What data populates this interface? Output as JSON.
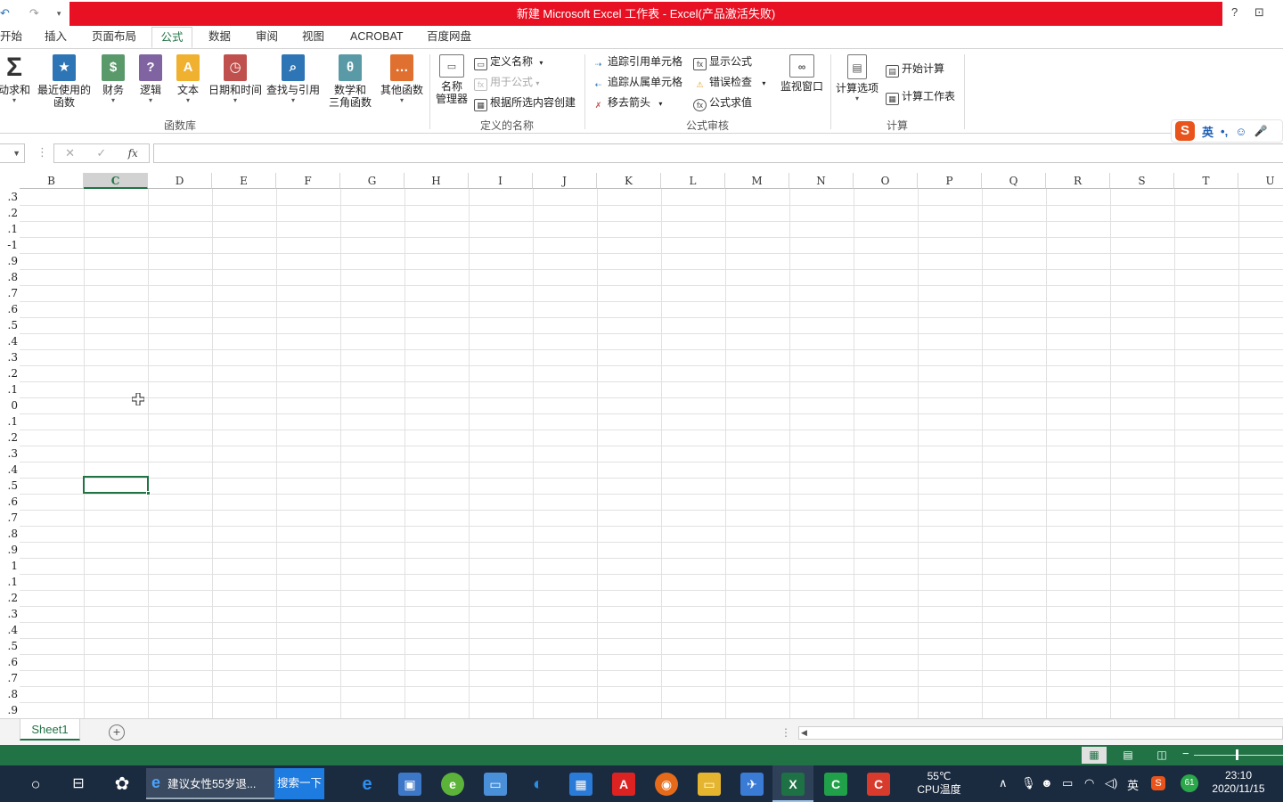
{
  "window": {
    "title": "新建 Microsoft Excel 工作表 - Excel(产品激活失败)",
    "help": "?",
    "restore": "⊡"
  },
  "qat": {
    "undo": "↶",
    "redo": "↷",
    "customize": "▾"
  },
  "tabs": [
    {
      "label": "开始"
    },
    {
      "label": "插入"
    },
    {
      "label": "页面布局"
    },
    {
      "label": "公式"
    },
    {
      "label": "数据"
    },
    {
      "label": "审阅"
    },
    {
      "label": "视图"
    },
    {
      "label": "ACROBAT"
    },
    {
      "label": "百度网盘"
    }
  ],
  "ribbon": {
    "function_library": {
      "label": "函数库",
      "buttons": [
        {
          "label": "动求和",
          "icon": "Σ"
        },
        {
          "label": "最近使用的\n函数",
          "icon": "★"
        },
        {
          "label": "财务",
          "icon": "$"
        },
        {
          "label": "逻辑",
          "icon": "?"
        },
        {
          "label": "文本",
          "icon": "A"
        },
        {
          "label": "日期和时间",
          "icon": "◷"
        },
        {
          "label": "查找与引用",
          "icon": "⌕"
        },
        {
          "label": "数学和\n三角函数",
          "icon": "θ"
        },
        {
          "label": "其他函数",
          "icon": "…"
        }
      ]
    },
    "defined_names": {
      "label": "定义的名称",
      "name_manager": "名称\n管理器",
      "define_name": "定义名称",
      "use_in_formula": "用于公式",
      "create_from_selection": "根据所选内容创建"
    },
    "formula_auditing": {
      "label": "公式审核",
      "trace_precedents": "追踪引用单元格",
      "trace_dependents": "追踪从属单元格",
      "remove_arrows": "移去箭头",
      "show_formulas": "显示公式",
      "error_checking": "错误检查",
      "evaluate_formula": "公式求值",
      "watch_window": "监视窗口"
    },
    "calculation": {
      "label": "计算",
      "calc_options": "计算选项",
      "calc_now": "开始计算",
      "calc_sheet": "计算工作表"
    }
  },
  "ime": {
    "logo": "S",
    "lang": "英",
    "punct": "•,",
    "emoji": "☺",
    "mic": "🎤"
  },
  "formula_bar": {
    "cancel": "✕",
    "enter": "✓",
    "fx": "fx",
    "value": ""
  },
  "columns": [
    "B",
    "C",
    "D",
    "E",
    "F",
    "G",
    "H",
    "I",
    "J",
    "K",
    "L",
    "M",
    "N",
    "O",
    "P",
    "Q",
    "R",
    "S",
    "T",
    "U"
  ],
  "selected_column": "C",
  "column_a_values": [
    ".3",
    ".2",
    ".1",
    "-1",
    ".9",
    ".8",
    ".7",
    ".6",
    ".5",
    ".4",
    ".3",
    ".2",
    ".1",
    "0",
    ".1",
    ".2",
    ".3",
    ".4",
    ".5",
    ".6",
    ".7",
    ".8",
    ".9",
    "1",
    ".1",
    ".2",
    ".3",
    ".4",
    ".5",
    ".6",
    ".7",
    ".8",
    ".9"
  ],
  "sheets": [
    {
      "name": "Sheet1"
    }
  ],
  "add_sheet": "+",
  "status": {
    "zoom_minus": "−"
  },
  "taskbar": {
    "browser_tab": "建议女性55岁退...",
    "search_btn": "搜索一下",
    "cpu_temp": "55℃",
    "cpu_label": "CPU温度",
    "ime_lang": "英",
    "badge": "61",
    "time": "23:10",
    "date": "2020/11/15"
  }
}
